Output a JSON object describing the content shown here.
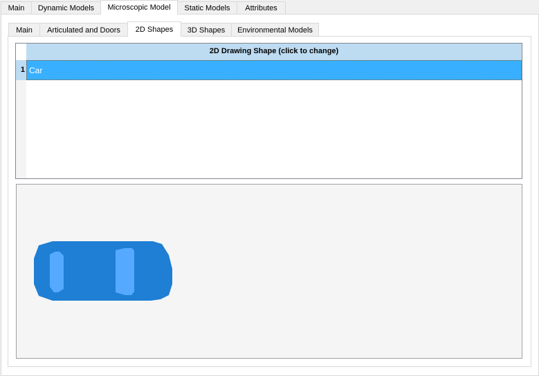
{
  "outer_tabs": [
    {
      "label": "Main",
      "selected": false
    },
    {
      "label": "Dynamic Models",
      "selected": false
    },
    {
      "label": "Microscopic Model",
      "selected": true
    },
    {
      "label": "Static Models",
      "selected": false
    },
    {
      "label": "Attributes",
      "selected": false
    }
  ],
  "inner_tabs": [
    {
      "label": "Main",
      "selected": false
    },
    {
      "label": "Articulated and Doors",
      "selected": false
    },
    {
      "label": "2D Shapes",
      "selected": true
    },
    {
      "label": "3D Shapes",
      "selected": false
    },
    {
      "label": "Environmental Models",
      "selected": false
    }
  ],
  "grid": {
    "column_header": "2D Drawing Shape (click to change)",
    "rows": [
      {
        "number": "1",
        "value": "Car",
        "selected": true
      }
    ]
  },
  "preview": {
    "shape": "car-icon",
    "colors": {
      "body": "#1e7fd4",
      "windows": "#55aaff",
      "background": "#f5f5f5"
    }
  },
  "colors": {
    "selection": "#38b0ff",
    "header": "#bddcf2"
  }
}
